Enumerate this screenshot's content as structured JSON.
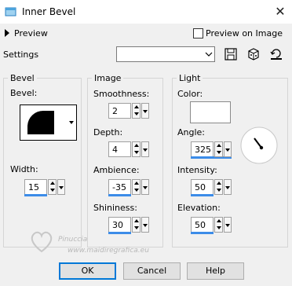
{
  "window": {
    "title": "Inner Bevel",
    "close_glyph": "✕"
  },
  "preview": {
    "label": "Preview",
    "preview_on_image_label": "Preview on Image",
    "preview_on_image_checked": false
  },
  "settings": {
    "label": "Settings",
    "preset_value": ""
  },
  "bevel": {
    "group_label": "Bevel",
    "bevel_label": "Bevel:",
    "width_label": "Width:",
    "width_value": "15"
  },
  "image": {
    "group_label": "Image",
    "smoothness_label": "Smoothness:",
    "smoothness_value": "2",
    "depth_label": "Depth:",
    "depth_value": "4",
    "ambience_label": "Ambience:",
    "ambience_value": "-35",
    "shininess_label": "Shininess:",
    "shininess_value": "30"
  },
  "light": {
    "group_label": "Light",
    "color_label": "Color:",
    "color_value": "#ffffff",
    "angle_label": "Angle:",
    "angle_value": "325",
    "intensity_label": "Intensity:",
    "intensity_value": "50",
    "elevation_label": "Elevation:",
    "elevation_value": "50"
  },
  "watermark": {
    "line1": "Pinuccia",
    "line2": "www.maidiregrafica.eu"
  },
  "buttons": {
    "ok": "OK",
    "cancel": "Cancel",
    "help": "Help"
  },
  "colors": {
    "accent": "#3c8ce8",
    "default_button_border": "#0078d7"
  },
  "icons": [
    "app-icon",
    "close-icon",
    "expand-triangle-icon",
    "save-preset-icon",
    "randomize-icon",
    "reset-icon",
    "dropdown-arrow-icon",
    "angle-dial-icon"
  ]
}
